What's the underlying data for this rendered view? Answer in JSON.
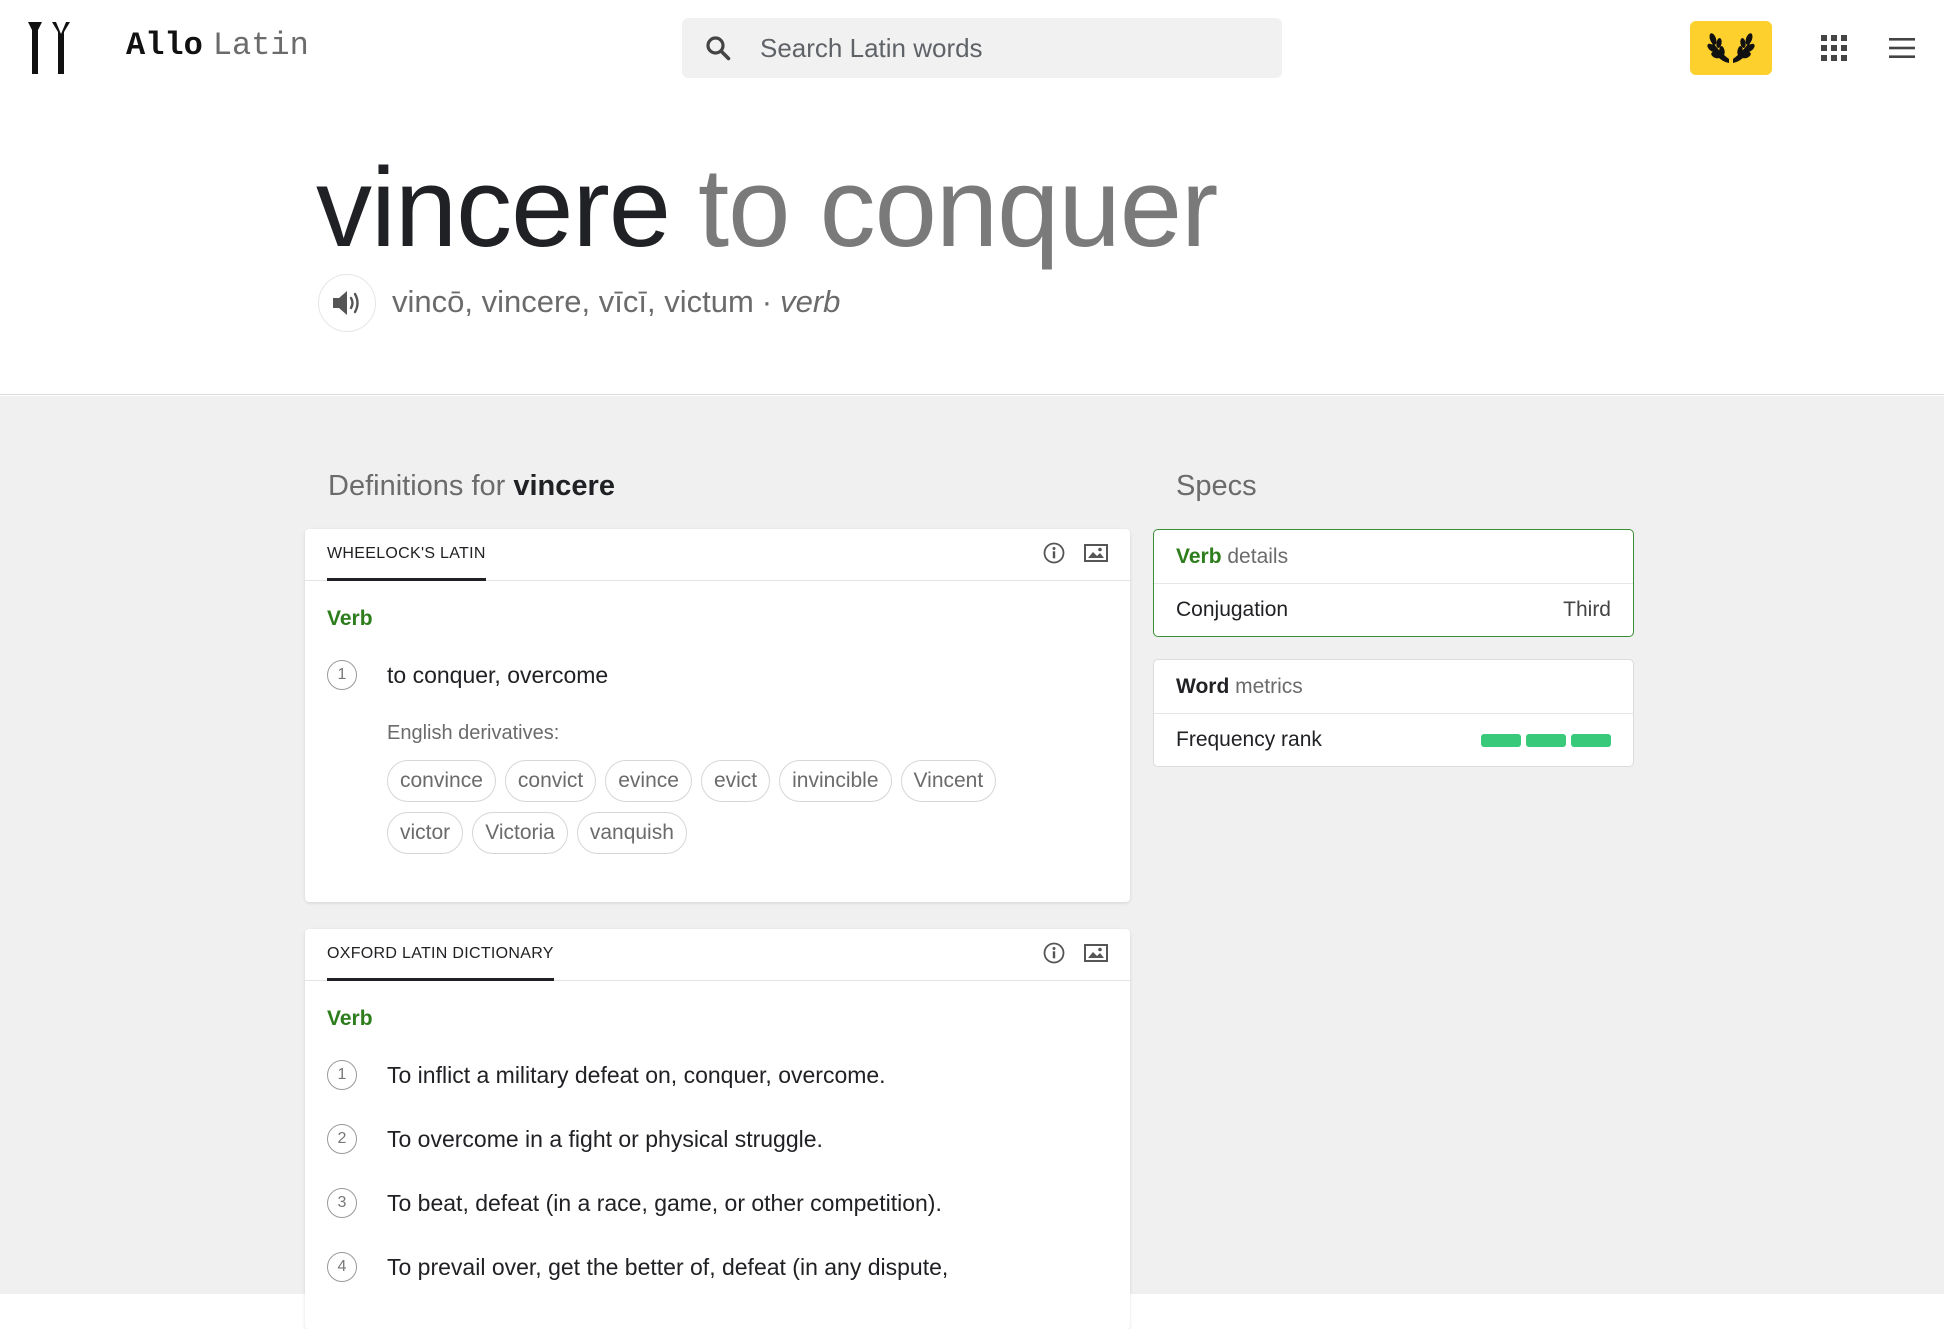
{
  "header": {
    "brand_primary": "Allo",
    "brand_secondary": "Latin",
    "search_placeholder": "Search Latin words",
    "icons": [
      "logo-icon",
      "search-icon",
      "laurel-icon",
      "apps-grid-icon",
      "hamburger-menu-icon"
    ]
  },
  "entry": {
    "lemma": "vincere",
    "gloss": "to conquer",
    "principal_parts": "vincō, vincere, vīcī, victum",
    "separator": "·",
    "part_of_speech": "verb"
  },
  "definitions": {
    "title_prefix": "Definitions for",
    "title_word": "vincere",
    "sources": [
      {
        "name": "WHEELOCK'S LATIN",
        "pos": "Verb",
        "senses": [
          {
            "n": "1",
            "text": "to conquer, overcome"
          }
        ],
        "derivatives_label": "English derivatives:",
        "derivatives": [
          "convince",
          "convict",
          "evince",
          "evict",
          "invincible",
          "Vincent",
          "victor",
          "Victoria",
          "vanquish"
        ]
      },
      {
        "name": "OXFORD LATIN DICTIONARY",
        "pos": "Verb",
        "senses": [
          {
            "n": "1",
            "text": "To inflict a military defeat on, conquer, overcome."
          },
          {
            "n": "2",
            "text": "To overcome in a fight or physical struggle."
          },
          {
            "n": "3",
            "text": "To beat, defeat (in a race, game, or other competition)."
          },
          {
            "n": "4",
            "text": "To prevail over, get the better of, defeat (in any dispute,"
          }
        ]
      }
    ]
  },
  "specs": {
    "title": "Specs",
    "verb_details": {
      "heading_strong": "Verb",
      "heading_rest": "details",
      "rows": [
        {
          "label": "Conjugation",
          "value": "Third"
        }
      ]
    },
    "word_metrics": {
      "heading_strong": "Word",
      "heading_rest": "metrics",
      "frequency_label": "Frequency rank",
      "frequency_bars_filled": 3,
      "frequency_bars_total": 3
    }
  },
  "colors": {
    "accent_yellow": "#fdd02e",
    "pos_green": "#2e7d1d",
    "frequency_green": "#38c97a",
    "active_border": "#3a8f34"
  }
}
